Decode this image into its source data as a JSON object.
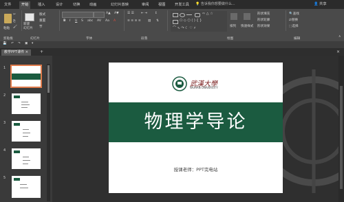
{
  "tabs": [
    "文件",
    "开始",
    "插入",
    "设计",
    "切换",
    "动画",
    "幻灯片放映",
    "审阅",
    "视图",
    "开发工具",
    "格式"
  ],
  "active_tab": "开始",
  "tell_me": "告诉我你想要做什么...",
  "share": "共享",
  "ribbon": {
    "paste": "粘贴",
    "new_slide": "新建\n幻灯片",
    "layout": "版式",
    "reset": "重置",
    "section": "节",
    "arrange": "排列",
    "quick_styles": "快速样式",
    "shape_fill": "形状填充",
    "shape_outline": "形状轮廓",
    "shape_effects": "形状效果",
    "find": "查找",
    "replace": "替换",
    "select": "选择",
    "groups": {
      "clipboard": "剪贴板",
      "slides": "幻灯片",
      "font": "字体",
      "paragraph": "段落",
      "drawing": "绘图",
      "editing": "编辑"
    }
  },
  "doc_tab": "教学PPT课件",
  "thumb_numbers": [
    "1",
    "2",
    "3",
    "4",
    "5"
  ],
  "slide": {
    "university": "武漢大學",
    "university_en": "WUHAN UNIVERSITY",
    "title": "物理学导论",
    "subtitle": "授课老师：PPT完电站"
  },
  "colors": {
    "band": "#1b5b40",
    "selected": "#e07b4b"
  }
}
